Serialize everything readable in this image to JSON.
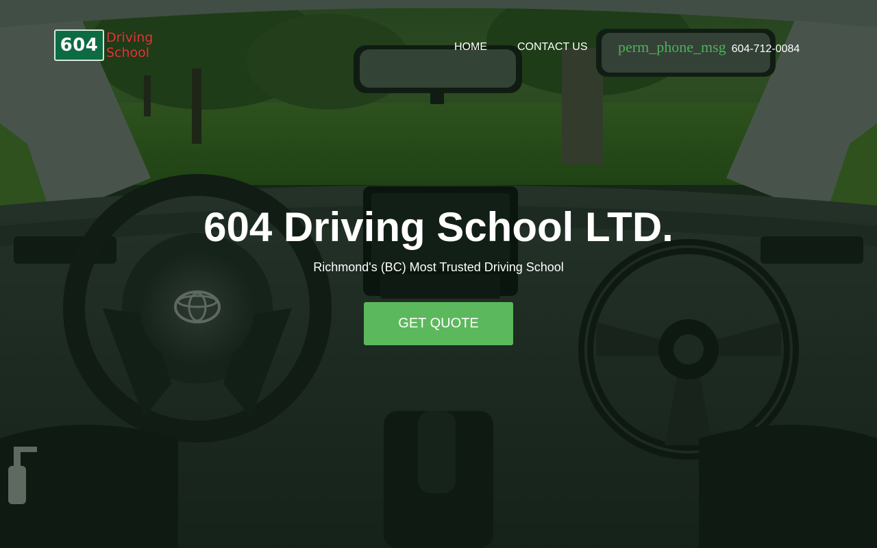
{
  "logo": {
    "badge_text": "604",
    "word_line1": "Driving",
    "word_line2": "School"
  },
  "nav": {
    "home_label": "HOME",
    "contact_label": "CONTACT US"
  },
  "phone": {
    "icon_text": "perm_phone_msg",
    "number": "604-712-0084"
  },
  "hero": {
    "title": "604 Driving School LTD.",
    "subtitle": "Richmond's (BC) Most Trusted Driving School",
    "cta_label": "GET QUOTE"
  },
  "colors": {
    "accent_green": "#5cb85c",
    "icon_green": "#4db15a",
    "logo_green": "#0c6b43",
    "logo_red": "#d93a3a",
    "overlay": "rgba(6,22,8,0.55)"
  },
  "icons": {
    "phone": "perm-phone-msg-icon",
    "steering_logo": "toyota-logo"
  }
}
